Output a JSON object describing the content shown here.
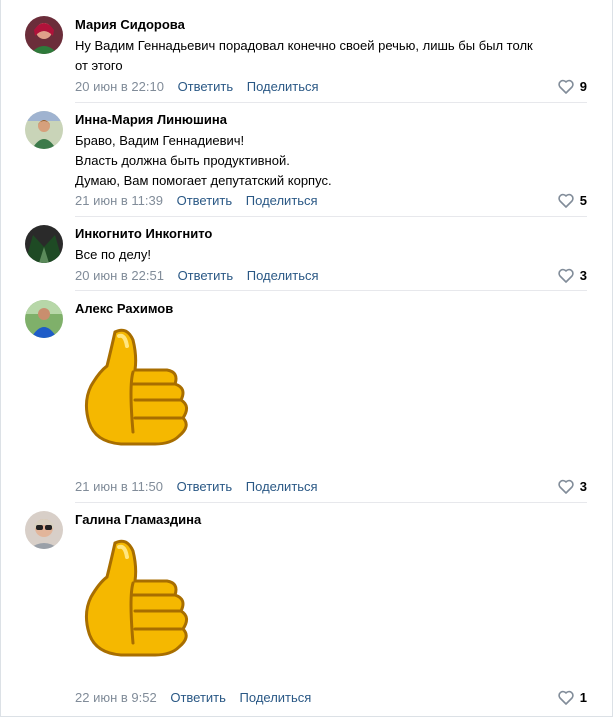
{
  "actions": {
    "reply": "Ответить",
    "share": "Поделиться"
  },
  "comments": [
    {
      "author": "Мария Сидорова",
      "lines": [
        "Ну Вадим Геннадьевич порадовал конечно своей речью, лишь бы был толк",
        "от этого"
      ],
      "date": "20 июн в 22:10",
      "likes": "9"
    },
    {
      "author": "Инна-Мария Линюшина",
      "lines": [
        "Браво, Вадим Геннадиевич!",
        "Власть должна быть продуктивной.",
        "Думаю, Вам помогает депутатский корпус."
      ],
      "date": "21 июн в 11:39",
      "likes": "5"
    },
    {
      "author": "Инкогнито Инкогнито",
      "lines": [
        "Все по делу!"
      ],
      "date": "20 июн в 22:51",
      "likes": "3"
    },
    {
      "author": "Алекс Рахимов",
      "lines": [],
      "sticker": "thumbs-up-sticker",
      "date": "21 июн в 11:50",
      "likes": "3"
    },
    {
      "author": "Галина Гламаздина",
      "lines": [],
      "sticker": "thumbs-up-sticker",
      "date": "22 июн в 9:52",
      "likes": "1"
    }
  ],
  "colors": {
    "link": "#2a5885",
    "muted": "#818c99",
    "divider": "#e7e8ec",
    "sticker": "#f5b800"
  }
}
